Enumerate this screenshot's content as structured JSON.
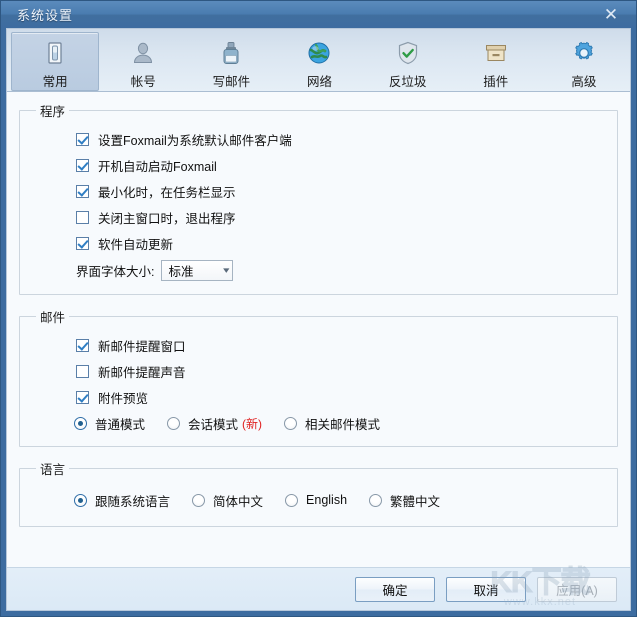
{
  "window": {
    "title": "系统设置",
    "close_label": "✕"
  },
  "tabs": [
    {
      "label": "常用",
      "icon": "general-icon",
      "active": true
    },
    {
      "label": "帐号",
      "icon": "account-icon",
      "active": false
    },
    {
      "label": "写邮件",
      "icon": "compose-icon",
      "active": false
    },
    {
      "label": "网络",
      "icon": "network-icon",
      "active": false
    },
    {
      "label": "反垃圾",
      "icon": "antispam-icon",
      "active": false
    },
    {
      "label": "插件",
      "icon": "plugin-icon",
      "active": false
    },
    {
      "label": "高级",
      "icon": "advanced-icon",
      "active": false
    }
  ],
  "groups": {
    "program": {
      "legend": "程序",
      "checkboxes": [
        {
          "label": "设置Foxmail为系统默认邮件客户端",
          "checked": true
        },
        {
          "label": "开机自动启动Foxmail",
          "checked": true
        },
        {
          "label": "最小化时，在任务栏显示",
          "checked": true
        },
        {
          "label": "关闭主窗口时，退出程序",
          "checked": false
        },
        {
          "label": "软件自动更新",
          "checked": true
        }
      ],
      "font_size_label": "界面字体大小:",
      "font_size_value": "标准",
      "font_size_options": [
        "标准"
      ]
    },
    "mail": {
      "legend": "邮件",
      "checkboxes": [
        {
          "label": "新邮件提醒窗口",
          "checked": true
        },
        {
          "label": "新邮件提醒声音",
          "checked": false
        },
        {
          "label": "附件预览",
          "checked": true
        }
      ],
      "radios": [
        {
          "label": "普通模式",
          "selected": true,
          "badge": ""
        },
        {
          "label": "会话模式",
          "selected": false,
          "badge": "(新)"
        },
        {
          "label": "相关邮件模式",
          "selected": false,
          "badge": ""
        }
      ]
    },
    "language": {
      "legend": "语言",
      "radios": [
        {
          "label": "跟随系统语言",
          "selected": true
        },
        {
          "label": "简体中文",
          "selected": false
        },
        {
          "label": "English",
          "selected": false
        },
        {
          "label": "繁體中文",
          "selected": false
        }
      ]
    }
  },
  "footer": {
    "ok_label": "确定",
    "cancel_label": "取消",
    "apply_label": "应用(A)",
    "apply_disabled": true
  },
  "watermark": {
    "main": "KK下载",
    "sub": "www.kkx.net"
  },
  "colors": {
    "titlebar": "#4a7cb0",
    "frame_border": "#3d6ca0",
    "content_bg": "#f7fafd",
    "tab_active": "#bdcee2",
    "accent_check": "#2f7ec4",
    "badge_new": "#e02020"
  }
}
